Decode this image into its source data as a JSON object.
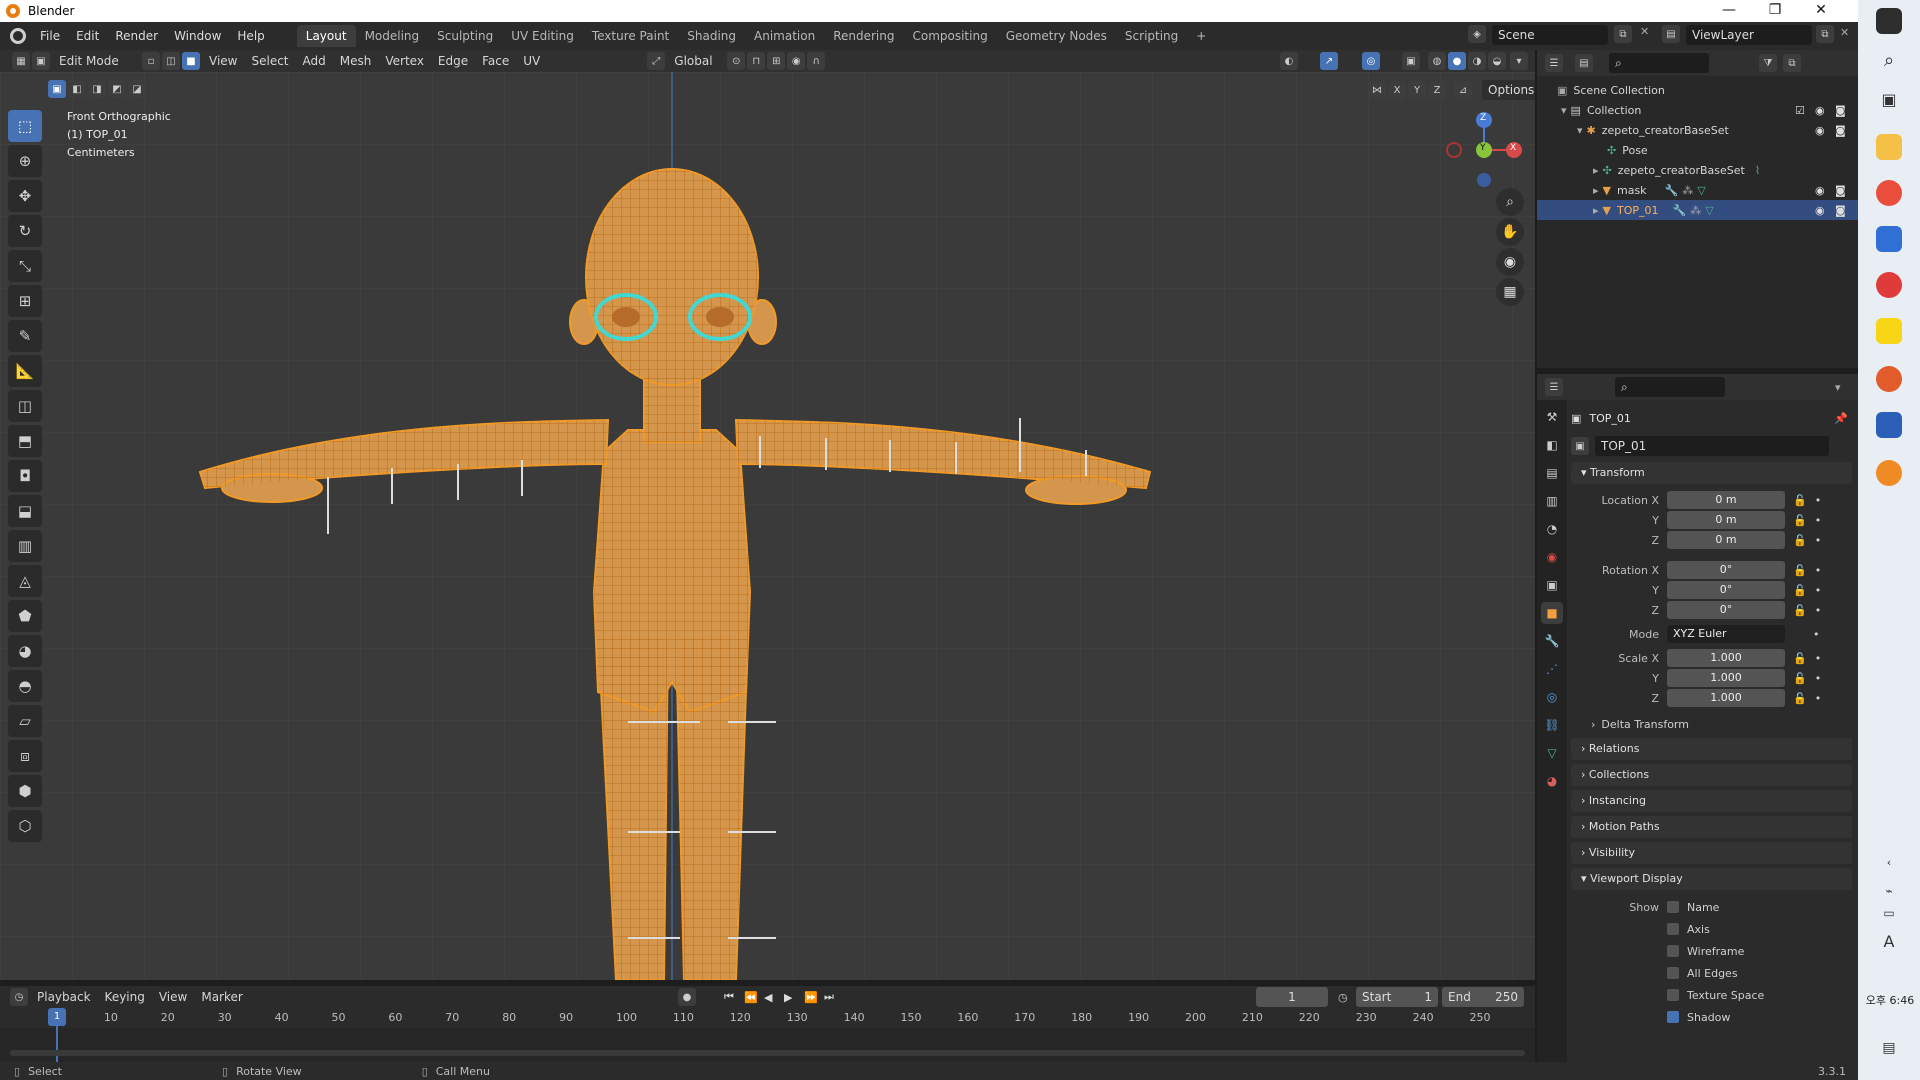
{
  "window": {
    "title": "Blender",
    "minimize": "—",
    "restore": "❐",
    "close": "✕"
  },
  "menus": [
    "File",
    "Edit",
    "Render",
    "Window",
    "Help"
  ],
  "workspaces": [
    "Layout",
    "Modeling",
    "Sculpting",
    "UV Editing",
    "Texture Paint",
    "Shading",
    "Animation",
    "Rendering",
    "Compositing",
    "Geometry Nodes",
    "Scripting"
  ],
  "workspace_add": "+",
  "scene": {
    "name": "Scene",
    "view_layer": "ViewLayer"
  },
  "header3d": {
    "mode": "Edit Mode",
    "menus": [
      "View",
      "Select",
      "Add",
      "Mesh",
      "Vertex",
      "Edge",
      "Face",
      "UV"
    ],
    "orientation": "Global",
    "options": "Options",
    "axes": [
      "X",
      "Y",
      "Z"
    ]
  },
  "viewport": {
    "view_name": "Front Orthographic",
    "object": "(1) TOP_01",
    "units": "Centimeters",
    "gizmo": {
      "z": "Z",
      "y": "Y",
      "x": "X"
    }
  },
  "outliner": {
    "root": "Scene Collection",
    "items": [
      {
        "label": "Collection",
        "depth": 1
      },
      {
        "label": "zepeto_creatorBaseSet",
        "depth": 2
      },
      {
        "label": "Pose",
        "depth": 3
      },
      {
        "label": "zepeto_creatorBaseSet",
        "depth": 3
      },
      {
        "label": "mask",
        "depth": 3
      },
      {
        "label": "TOP_01",
        "depth": 3
      }
    ]
  },
  "properties": {
    "object_name": "TOP_01",
    "data_name": "TOP_01",
    "transform_title": "Transform",
    "location_label": "Location X",
    "rotation_label": "Rotation X",
    "scale_label": "Scale X",
    "y_label": "Y",
    "z_label": "Z",
    "location": [
      "0 m",
      "0 m",
      "0 m"
    ],
    "rotation": [
      "0°",
      "0°",
      "0°"
    ],
    "mode_label": "Mode",
    "mode_value": "XYZ Euler",
    "scale": [
      "1.000",
      "1.000",
      "1.000"
    ],
    "delta": "Delta Transform",
    "panels": [
      "Relations",
      "Collections",
      "Instancing",
      "Motion Paths",
      "Visibility"
    ],
    "viewport_display": "Viewport Display",
    "show_label": "Show",
    "show_options": [
      {
        "label": "Name",
        "checked": false
      },
      {
        "label": "Axis",
        "checked": false
      },
      {
        "label": "Wireframe",
        "checked": false
      },
      {
        "label": "All Edges",
        "checked": false
      },
      {
        "label": "Texture Space",
        "checked": false
      },
      {
        "label": "Shadow",
        "checked": true
      }
    ]
  },
  "timeline": {
    "menus": [
      "Playback",
      "Keying",
      "View",
      "Marker"
    ],
    "current_frame": "1",
    "start_label": "Start",
    "start": "1",
    "end_label": "End",
    "end": "250",
    "ticks": [
      "10",
      "20",
      "30",
      "40",
      "50",
      "60",
      "70",
      "80",
      "90",
      "100",
      "110",
      "120",
      "130",
      "140",
      "150",
      "160",
      "170",
      "180",
      "190",
      "200",
      "210",
      "220",
      "230",
      "240",
      "250"
    ],
    "playhead": "1"
  },
  "status": {
    "select": "Select",
    "rotate": "Rotate View",
    "menu": "Call Menu",
    "version": "3.3.1"
  },
  "taskbar": {
    "time_line1": "오후 6:46",
    "keyboard": "A"
  },
  "colors": {
    "accent": "#4772b3",
    "mesh_wire": "#e8901e",
    "selected_row": "#334d80"
  }
}
